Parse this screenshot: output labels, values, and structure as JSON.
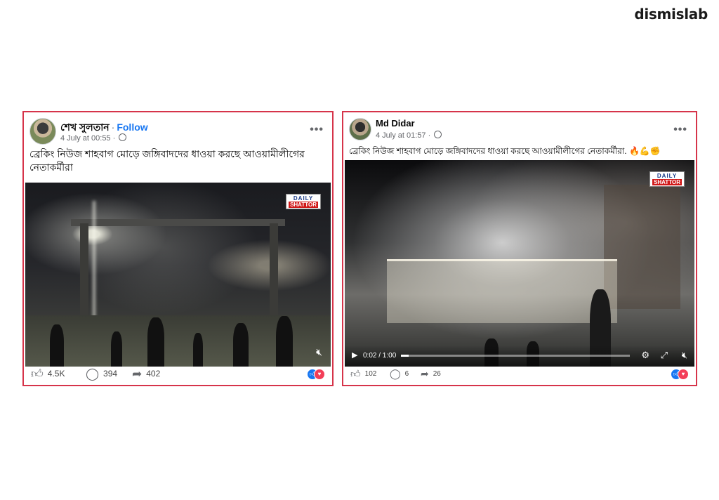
{
  "brand": {
    "logo": "dismislab"
  },
  "posts": [
    {
      "author": "শেখ সুলতান",
      "follow_label": "Follow",
      "date": "4 July at 00:55",
      "caption": "ব্রেকিং নিউজ শাহবাগ মোড়ে জঙ্গিবাদদের ধাওয়া করছে আওয়ামীলীগের নেতাকর্মীরা",
      "watermark": {
        "line1": "DAILY",
        "line2": "SHATTOR"
      },
      "actions": {
        "likes": "4.5K",
        "comments": "394",
        "shares": "402"
      },
      "icons": [
        "avatar",
        "globe-icon",
        "more-icon",
        "mute-icon",
        "like-icon",
        "comment-icon",
        "share-icon",
        "like-reaction-icon",
        "love-reaction-icon"
      ]
    },
    {
      "author": "Md Didar",
      "date": "4 July at 01:57",
      "caption": "ব্রেকিং নিউজ শাহবাগ মোড়ে জঙ্গিবাদদের ধাওয়া করছে আওয়ামীলীগের নেতাকর্মীরা. 🔥💪✊",
      "watermark": {
        "line1": "DAILY",
        "line2": "SHATTOR"
      },
      "video": {
        "time": "0:02 / 1:00",
        "progress": 0.033
      },
      "actions": {
        "likes": "102",
        "comments": "6",
        "shares": "26"
      },
      "icons": [
        "avatar",
        "globe-icon",
        "more-icon",
        "play-icon",
        "settings-icon",
        "fullscreen-icon",
        "mute-icon",
        "like-icon",
        "comment-icon",
        "share-icon",
        "like-reaction-icon",
        "love-reaction-icon"
      ]
    }
  ],
  "colors": {
    "highlight_border": "#d6344a",
    "follow": "#1877f2",
    "like": "#1877f2",
    "love": "#f33e58"
  }
}
